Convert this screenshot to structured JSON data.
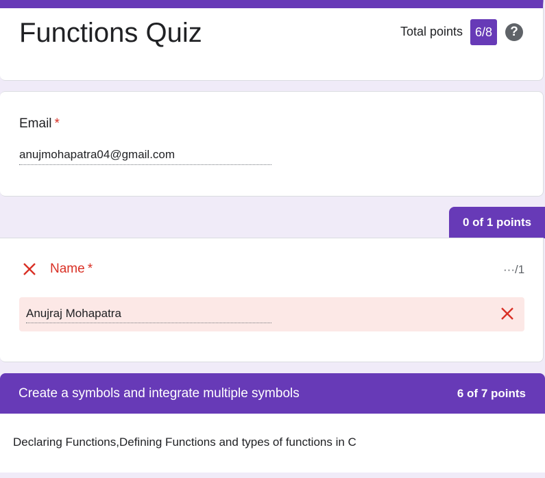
{
  "header": {
    "title": "Functions Quiz",
    "total_points_label": "Total points",
    "total_points_value": "6/8",
    "help_glyph": "?"
  },
  "email_question": {
    "label": "Email",
    "required_mark": "*",
    "value": "anujmohapatra04@gmail.com"
  },
  "name_question": {
    "points_tab": "0 of 1 points",
    "label": "Name",
    "required_mark": "*",
    "score": "···/1",
    "answer": "Anujraj Mohapatra",
    "status": "incorrect",
    "icon": "close-icon"
  },
  "section": {
    "title": "Create a symbols and integrate multiple symbols",
    "points": "6 of 7 points",
    "description": "Declaring Functions,Defining Functions and types of functions in C"
  },
  "colors": {
    "accent": "#673ab7",
    "background": "#f0ebf8",
    "error": "#d93025",
    "error_bg": "#fce8e6"
  }
}
